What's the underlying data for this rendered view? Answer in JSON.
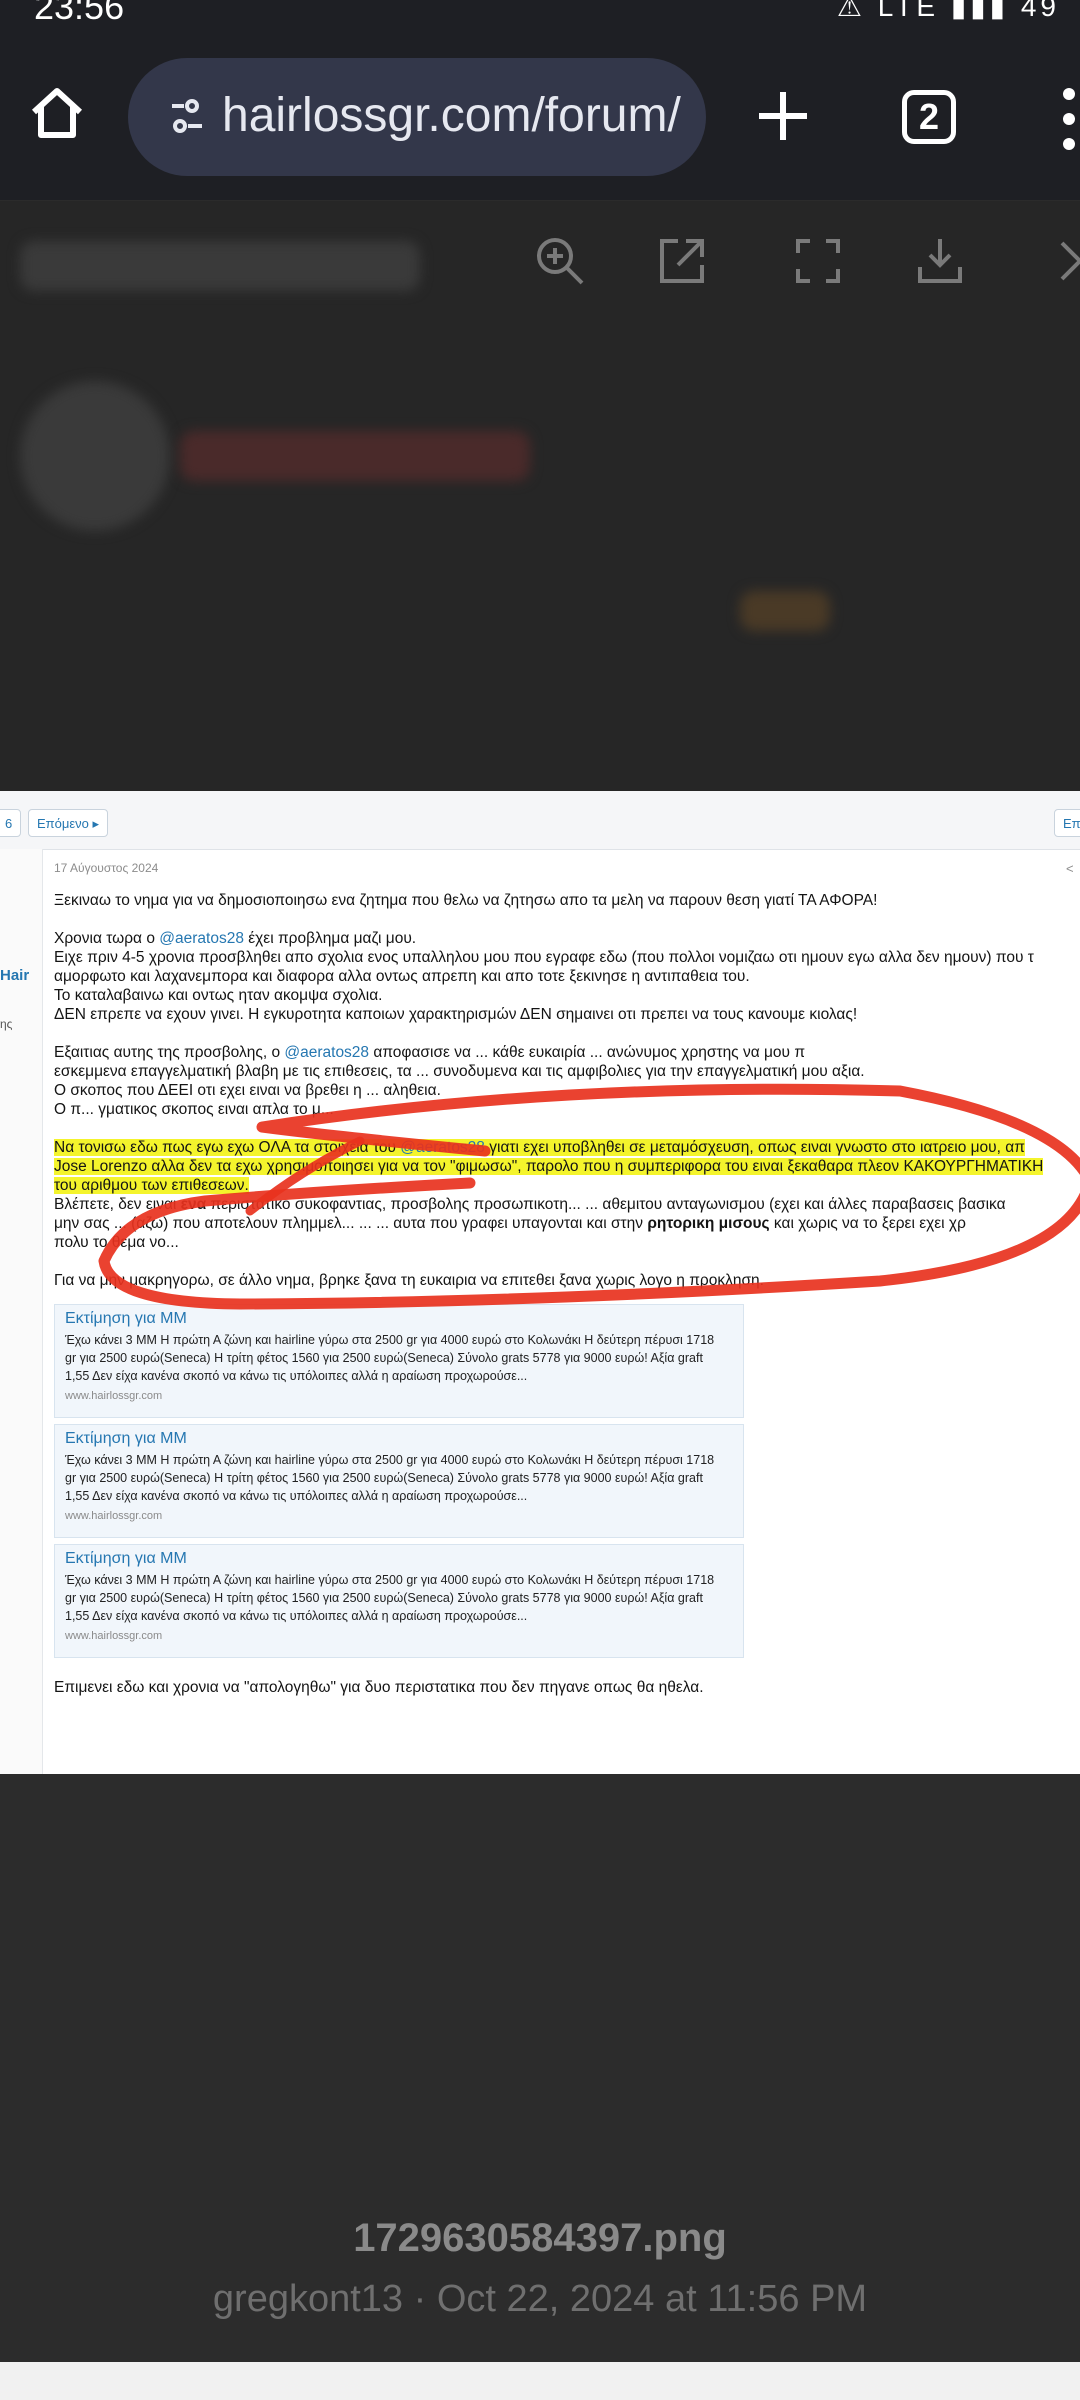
{
  "status": {
    "time": "23:56",
    "icons": "⚠ LTE ▮▮▮ 49"
  },
  "browser": {
    "url": "hairlossgr.com/forum/",
    "tab_count": "2",
    "icons": [
      "home-icon",
      "tune-icon",
      "plus-icon",
      "tabs-icon",
      "more-vert-icon"
    ]
  },
  "viewer_toolbar": {
    "icons": [
      "zoom-in-icon",
      "open-external-icon",
      "fullscreen-icon",
      "download-icon",
      "close-icon"
    ]
  },
  "screenshot": {
    "pager": {
      "page_label": "6",
      "next_label": "Επόμενο ▸",
      "right_label": "Επι"
    },
    "sidebar": {
      "username": "Hair",
      "letters": "ης"
    },
    "date": "17 Αύγουστος 2024",
    "post_lines": [
      {
        "parts": [
          {
            "t": "Ξεκιναω το νημα για να δημοσιοποιησω ενα ζητημα που θελω να ζητησω απο τα μελη να παρουν θεση γιατί ΤΑ ΑΦΟΡΑ!"
          }
        ]
      },
      {
        "gap": true
      },
      {
        "parts": [
          {
            "t": "Χρονια τωρα ο "
          },
          {
            "t": "@aeratos28",
            "c": "mention"
          },
          {
            "t": " έχει προβλημα μαζι μου."
          }
        ]
      },
      {
        "parts": [
          {
            "t": "Ειχε πριν 4-5 χρονια προσβληθει απο σχολια ενος υπαλληλου μου που εγραφε εδω (που πολλοι νομιζαω οτι ημουν εγω αλλα δεν ημουν) που τ"
          }
        ]
      },
      {
        "parts": [
          {
            "t": "αμορφωτο και λαχανεμπορα και διαφορα αλλα οντως απρεπη και απο τοτε ξεκινησε η αντιπαθεια του."
          }
        ]
      },
      {
        "parts": [
          {
            "t": "Το καταλαβαινω και οντως ηταν ακομψα σχολια."
          }
        ]
      },
      {
        "parts": [
          {
            "t": "ΔΕΝ επρεπε να εχουν γινει. Η εγκυροτητα καποιων χαρακτηρισμών ΔΕΝ σημαινει οτι πρεπει να τους κανουμε κιολας!"
          }
        ]
      },
      {
        "gap": true
      },
      {
        "parts": [
          {
            "t": "Εξαιτιας αυτης της προσβολης, ο "
          },
          {
            "t": "@aeratos28",
            "c": "mention"
          },
          {
            "t": " αποφασισε να ... κάθε ευκαιρία ... ανώνυμος χρηστης να μου π"
          }
        ]
      },
      {
        "parts": [
          {
            "t": "εσκεμμενα επαγγελματική βλαβη με τις επιθεσεις, τα ... συνοδυμενα και τις αμφιβολιες για την επαγγελματική μου αξια."
          }
        ]
      },
      {
        "parts": [
          {
            "t": "Ο σκοπος που ΔΕΕΙ οτι εχει ειναι να βρεθει η ... αληθεια."
          }
        ]
      },
      {
        "parts": [
          {
            "t": "Ο π... γματικος σκοπος ειναι απλα το μ..."
          }
        ]
      },
      {
        "gap": true
      },
      {
        "parts": [
          {
            "t": "Να τονισω εδω πως εγω εχω ΟΛΑ τα στοιχεια του ",
            "c": "hl"
          },
          {
            "t": "@aeratos28",
            "c": "hl mention"
          },
          {
            "t": " γιατι εχει υποβληθει σε μεταμόσχευση, οπως ειναι γνωστο στο ιατρειο μου, απ",
            "c": "hl"
          }
        ]
      },
      {
        "parts": [
          {
            "t": "Jose Lorenzo αλλα δεν τα εχω χρησιμοποιησει για να τον \"φιμωσω\", παρολο που η συμπεριφορα του ειναι ξεκαθαρα πλεον ΚΑΚΟΥΡΓΗΜΑΤΙΚΗ",
            "c": "hl"
          }
        ]
      },
      {
        "parts": [
          {
            "t": "του αριθμου των επιθεσεων.",
            "c": "hl"
          }
        ]
      },
      {
        "parts": [
          {
            "t": "Βλέπετε, δεν ειναι "
          },
          {
            "t": "ενα",
            "c": "b"
          },
          {
            "t": " περιστατικο συκοφαντιας, προσβολης προσωπικοτη... ... αθεμιτου ανταγωνισμου (εχει και άλλες παραβασεις βασικα"
          }
        ]
      },
      {
        "parts": [
          {
            "t": "μην σας ... (αζω) που αποτελουν πλημμελ... ... ... αυτα που γραφει υπαγονται και στην "
          },
          {
            "t": "ρητορικη μισους",
            "c": "b"
          },
          {
            "t": " και χωρις να το ξερει εχει χρ"
          }
        ]
      },
      {
        "parts": [
          {
            "t": "πολυ το θεμα νο..."
          }
        ]
      },
      {
        "gap": true
      },
      {
        "parts": [
          {
            "t": "Για να μην μακρηγορω, σε άλλο νημα, βρηκε ξανα τη ευκαιρια να επιτεθει ξανα χωρις λογο η προκληση."
          }
        ]
      }
    ],
    "quotes": [
      {
        "title": "Εκτίμηση για ΜΜ",
        "text": [
          "Έχω κάνει 3 ΜΜ Η πρώτη Α ζώνη και hairline γύρω στα 2500 gr για 4000 ευρώ στο Κολωνάκι Η δεύτερη πέρυσι 1718",
          "gr για 2500 ευρώ(Seneca) Η τρίτη φέτος 1560 για 2500 ευρώ(Seneca) Σύνολο grats 5778 για 9000 ευρώ! Αξία graft",
          "1,55 Δεν είχα κανένα σκοπό να κάνω τις υπόλοιπες αλλά η αραίωση προχωρούσε..."
        ],
        "site": "www.hairlossgr.com"
      },
      {
        "title": "Εκτίμηση για ΜΜ",
        "text": [
          "Έχω κάνει 3 ΜΜ Η πρώτη Α ζώνη και hairline γύρω στα 2500 gr για 4000 ευρώ στο Κολωνάκι Η δεύτερη πέρυσι 1718",
          "gr για 2500 ευρώ(Seneca) Η τρίτη φέτος 1560 για 2500 ευρώ(Seneca) Σύνολο grats 5778 για 9000 ευρώ! Αξία graft",
          "1,55 Δεν είχα κανένα σκοπό να κάνω τις υπόλοιπες αλλά η αραίωση προχωρούσε..."
        ],
        "site": "www.hairlossgr.com"
      },
      {
        "title": "Εκτίμηση για ΜΜ",
        "text": [
          "Έχω κάνει 3 ΜΜ Η πρώτη Α ζώνη και hairline γύρω στα 2500 gr για 4000 ευρώ στο Κολωνάκι Η δεύτερη πέρυσι 1718",
          "gr για 2500 ευρώ(Seneca) Η τρίτη φέτος 1560 για 2500 ευρώ(Seneca) Σύνολο grats 5778 για 9000 ευρώ! Αξία graft",
          "1,55 Δεν είχα κανένα σκοπό να κάνω τις υπόλοιπες αλλά η αραίωση προχωρούσε..."
        ],
        "site": "www.hairlossgr.com"
      }
    ],
    "last_line": "Επιμενει εδω και χρονια να \"απολογηθω\" για δυο περιστατικα που δεν πηγανε οπως θα ηθελα.",
    "colors": {
      "mention": "#2577b1",
      "highlight": "#f4f42c",
      "scribble": "#e8321e"
    }
  },
  "file": {
    "name": "1729630584397.png",
    "meta": "gregkont13 · Oct 22, 2024 at 11:56 PM"
  }
}
